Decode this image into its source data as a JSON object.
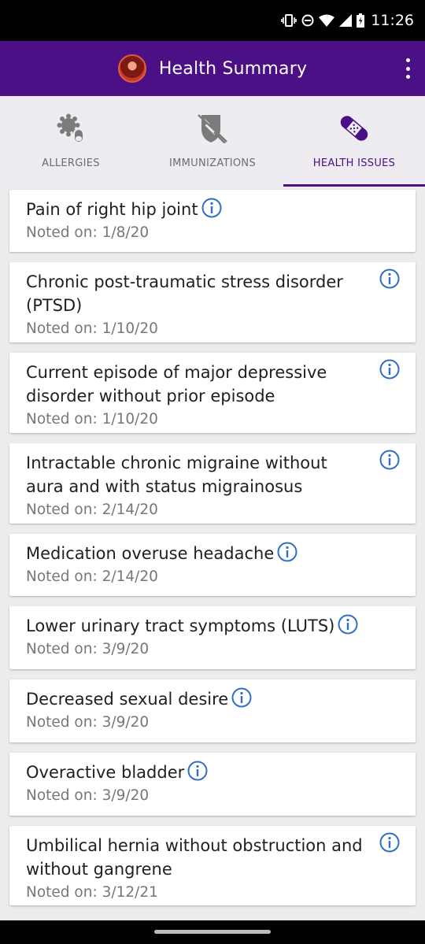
{
  "status_bar": {
    "time": "11:26"
  },
  "app_bar": {
    "title": "Health Summary"
  },
  "tabs": [
    {
      "label": "ALLERGIES",
      "icon": "allergy-icon",
      "active": false
    },
    {
      "label": "IMMUNIZATIONS",
      "icon": "vaccine-icon",
      "active": false
    },
    {
      "label": "HEALTH ISSUES",
      "icon": "bandage-icon",
      "active": true
    }
  ],
  "issues": [
    {
      "name": "Pain of right hip joint",
      "noted": "Noted on: 1/8/20"
    },
    {
      "name": "Chronic post-traumatic stress disorder (PTSD)",
      "noted": "Noted on: 1/10/20"
    },
    {
      "name": "Current episode of major depressive disorder without prior episode",
      "noted": "Noted on: 1/10/20"
    },
    {
      "name": "Intractable chronic migraine without aura and with status migrainosus",
      "noted": "Noted on: 2/14/20"
    },
    {
      "name": "Medication overuse headache",
      "noted": "Noted on: 2/14/20"
    },
    {
      "name": "Lower urinary tract symptoms (LUTS)",
      "noted": "Noted on: 3/9/20"
    },
    {
      "name": "Decreased sexual desire",
      "noted": "Noted on: 3/9/20"
    },
    {
      "name": "Overactive bladder",
      "noted": "Noted on: 3/9/20"
    },
    {
      "name": "Umbilical hernia without obstruction and without gangrene",
      "noted": "Noted on: 3/12/21"
    }
  ],
  "colors": {
    "primary": "#4b0f86",
    "info_blue": "#2f6fc4"
  }
}
